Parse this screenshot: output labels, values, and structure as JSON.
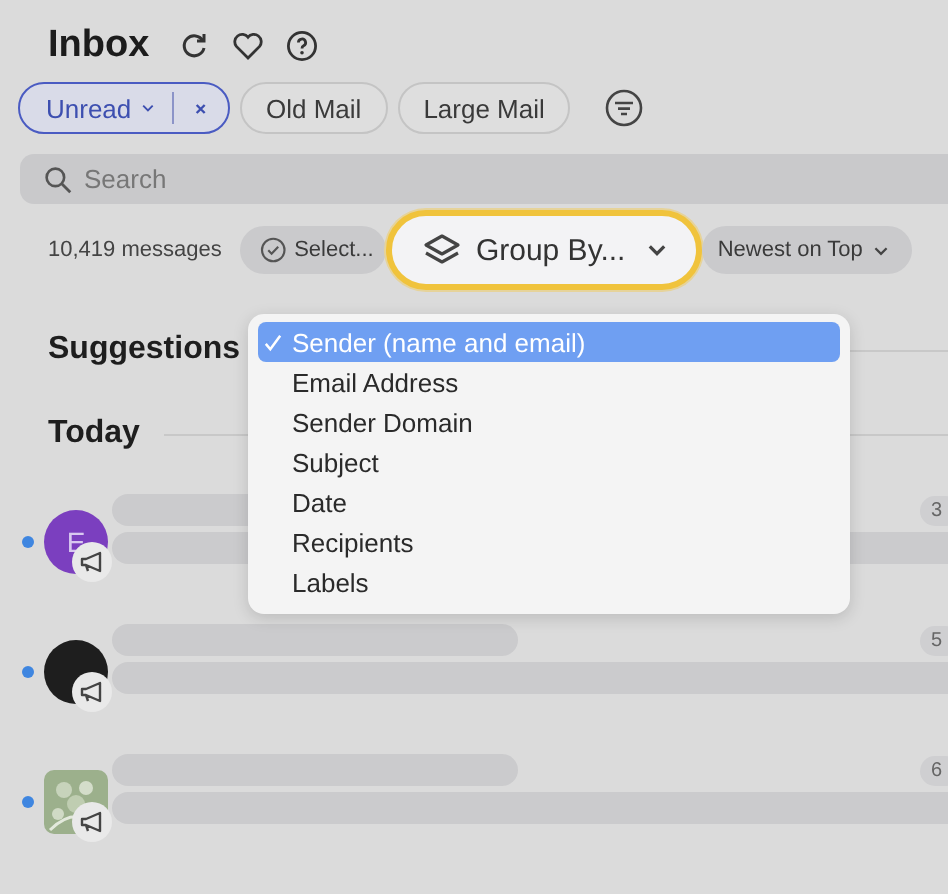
{
  "header": {
    "title": "Inbox"
  },
  "filters": [
    {
      "label": "Unread",
      "selected": true
    },
    {
      "label": "Old Mail",
      "selected": false
    },
    {
      "label": "Large Mail",
      "selected": false
    }
  ],
  "search": {
    "placeholder": "Search"
  },
  "toolbar": {
    "count": "10,419 messages",
    "select": "Select...",
    "group_by": "Group By...",
    "sort": "Newest on Top"
  },
  "sections": [
    {
      "title": "Suggestions"
    },
    {
      "title": "Today"
    }
  ],
  "group_menu": [
    {
      "label": "Sender (name and email)",
      "selected": true
    },
    {
      "label": "Email Address",
      "selected": false
    },
    {
      "label": "Sender Domain",
      "selected": false
    },
    {
      "label": "Subject",
      "selected": false
    },
    {
      "label": "Date",
      "selected": false
    },
    {
      "label": "Recipients",
      "selected": false
    },
    {
      "label": "Labels",
      "selected": false
    }
  ],
  "messages": [
    {
      "unread": true,
      "avatar": {
        "kind": "initial",
        "text": "E",
        "color": "#7b3fbf"
      },
      "count": "3"
    },
    {
      "unread": true,
      "avatar": {
        "kind": "logo"
      },
      "count": "5"
    },
    {
      "unread": true,
      "count": "6"
    }
  ]
}
